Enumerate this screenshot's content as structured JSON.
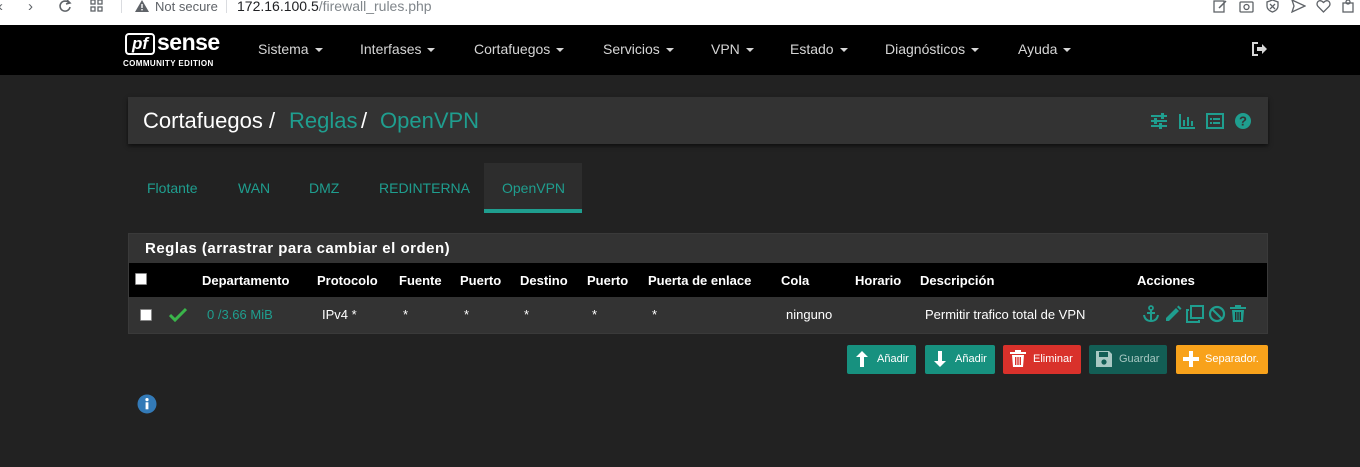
{
  "browser": {
    "security_label": "Not secure",
    "url_host": "172.16.100.5",
    "url_path": "/firewall_rules.php"
  },
  "logo": {
    "pf": "pf",
    "sense": "sense",
    "edition": "COMMUNITY EDITION"
  },
  "nav": {
    "items": [
      {
        "label": "Sistema"
      },
      {
        "label": "Interfases"
      },
      {
        "label": "Cortafuegos"
      },
      {
        "label": "Servicios"
      },
      {
        "label": "VPN"
      },
      {
        "label": "Estado"
      },
      {
        "label": "Diagnósticos"
      },
      {
        "label": "Ayuda"
      }
    ],
    "logout_icon": "sign-out-icon"
  },
  "breadcrumb": {
    "root": "Cortafuegos",
    "sep1": "/",
    "level2": "Reglas",
    "sep2": "/",
    "level3": "OpenVPN",
    "tool_icons": [
      "sliders-icon",
      "bar-chart-icon",
      "list-icon",
      "help-icon"
    ]
  },
  "tabs": [
    {
      "label": "Flotante"
    },
    {
      "label": "WAN"
    },
    {
      "label": "DMZ"
    },
    {
      "label": "REDINTERNA"
    },
    {
      "label": "OpenVPN",
      "active": true
    }
  ],
  "rules": {
    "title": "Reglas (arrastrar para cambiar el orden)",
    "columns": [
      "Departamento",
      "Protocolo",
      "Fuente",
      "Puerto",
      "Destino",
      "Puerto",
      "Puerta de enlace",
      "Cola",
      "Horario",
      "Descripción",
      "Acciones"
    ],
    "rows": [
      {
        "states": "0 /3.66 MiB",
        "protocol": "IPv4 *",
        "source": "*",
        "source_port": "*",
        "destination": "*",
        "destination_port": "*",
        "gateway": "*",
        "queue": "ninguno",
        "schedule": "",
        "description": "Permitir trafico total de VPN",
        "status_icon": "check-icon",
        "action_icons": [
          "anchor-icon",
          "pencil-icon",
          "copy-icon",
          "disable-icon",
          "trash-icon"
        ]
      }
    ]
  },
  "buttons": {
    "add_top": "Añadir",
    "add_bottom": "Añadir",
    "delete": "Eliminar",
    "save": "Guardar",
    "separator": "Separador."
  },
  "colors": {
    "teal": "#1f9e8f",
    "green_check": "#3ab54a",
    "danger": "#d9312b",
    "warning": "#f8a21b",
    "info": "#337ab7"
  }
}
